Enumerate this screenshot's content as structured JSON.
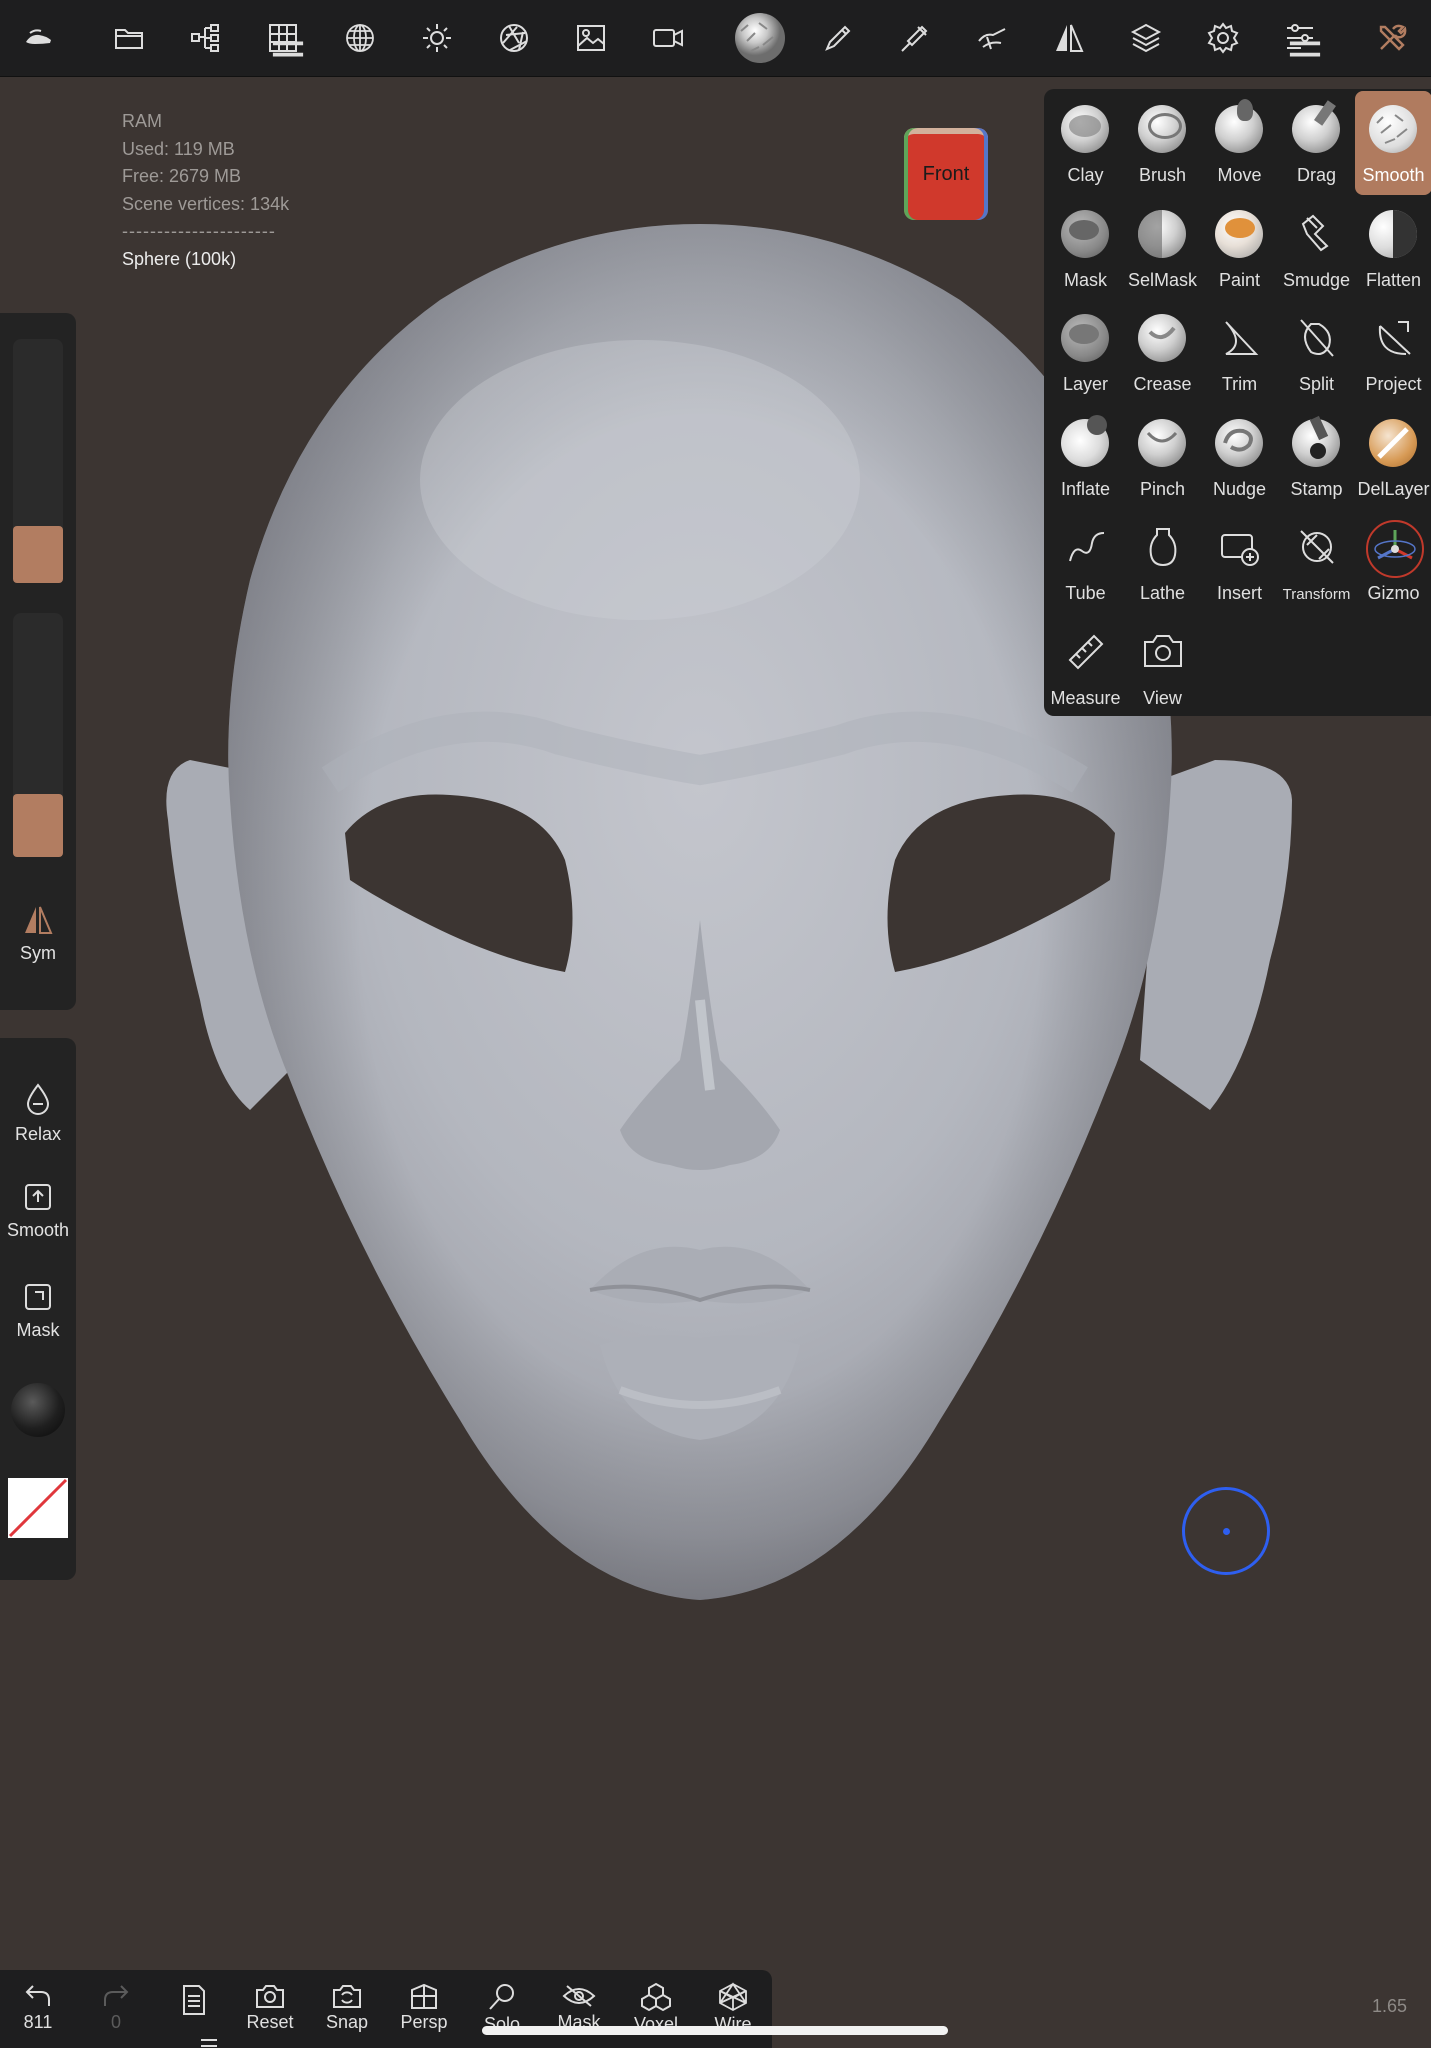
{
  "topbar": {
    "icons": [
      "app-logo-icon",
      "folder-icon",
      "scene-tree-icon",
      "grid-icon",
      "topology-icon",
      "light-icon",
      "aperture-icon",
      "image-icon",
      "camera-icon",
      "material-ball-icon",
      "brush-pen-icon",
      "paint-brush-icon",
      "hand-brush-icon",
      "symmetry-icon",
      "layers-icon",
      "settings-icon",
      "sliders-icon",
      "tools-icon"
    ],
    "accent": "#b27d61"
  },
  "stats": {
    "ram_label": "RAM",
    "used": "Used: 119 MB",
    "free": "Free: 2679 MB",
    "scene_vertices": "Scene vertices: 134k",
    "separator": "----------------------",
    "object_name": "Sphere (100k)"
  },
  "view_cube": {
    "face_label": "Front"
  },
  "left_panel": {
    "radius_level": 0.3,
    "intensity_level": 0.35,
    "sym_label": "Sym",
    "relax_label": "Relax",
    "smooth_label": "Smooth",
    "mask_label": "Mask"
  },
  "tools": [
    {
      "label": "Clay",
      "icon": "clay-icon"
    },
    {
      "label": "Brush",
      "icon": "brush-icon"
    },
    {
      "label": "Move",
      "icon": "move-icon"
    },
    {
      "label": "Drag",
      "icon": "drag-icon"
    },
    {
      "label": "Smooth",
      "icon": "smooth-icon",
      "active": true
    },
    {
      "label": "Mask",
      "icon": "mask-icon"
    },
    {
      "label": "SelMask",
      "icon": "selmask-icon"
    },
    {
      "label": "Paint",
      "icon": "paint-icon"
    },
    {
      "label": "Smudge",
      "icon": "smudge-icon"
    },
    {
      "label": "Flatten",
      "icon": "flatten-icon"
    },
    {
      "label": "Layer",
      "icon": "layer-icon"
    },
    {
      "label": "Crease",
      "icon": "crease-icon"
    },
    {
      "label": "Trim",
      "icon": "trim-icon"
    },
    {
      "label": "Split",
      "icon": "split-icon"
    },
    {
      "label": "Project",
      "icon": "project-icon"
    },
    {
      "label": "Inflate",
      "icon": "inflate-icon"
    },
    {
      "label": "Pinch",
      "icon": "pinch-icon"
    },
    {
      "label": "Nudge",
      "icon": "nudge-icon"
    },
    {
      "label": "Stamp",
      "icon": "stamp-icon"
    },
    {
      "label": "DelLayer",
      "icon": "dellayer-icon"
    },
    {
      "label": "Tube",
      "icon": "tube-icon"
    },
    {
      "label": "Lathe",
      "icon": "lathe-icon"
    },
    {
      "label": "Insert",
      "icon": "insert-icon"
    },
    {
      "label": "Transform",
      "icon": "transform-icon"
    },
    {
      "label": "Gizmo",
      "icon": "gizmo-icon"
    },
    {
      "label": "Measure",
      "icon": "measure-icon"
    },
    {
      "label": "View",
      "icon": "view-icon"
    }
  ],
  "bottombar": {
    "undo_count": "811",
    "redo_count": "0",
    "reset_label": "Reset",
    "snap_label": "Snap",
    "persp_label": "Persp",
    "solo_label": "Solo",
    "mask_label": "Mask",
    "voxel_label": "Voxel",
    "wire_label": "Wire"
  },
  "zoom": "1.65"
}
